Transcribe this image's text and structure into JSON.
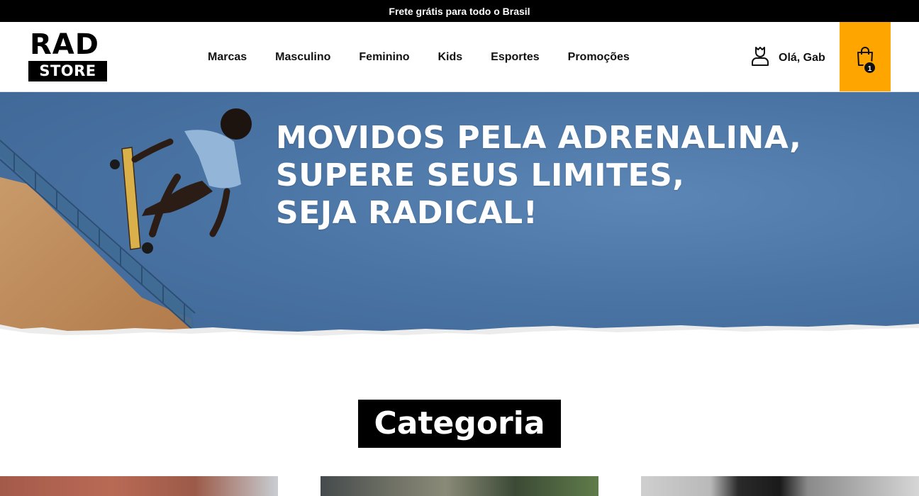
{
  "topbar": {
    "text": "Frete grátis para todo o Brasil"
  },
  "logo": {
    "line1": "RAD",
    "line2": "STORE"
  },
  "nav": {
    "items": [
      {
        "label": "Marcas"
      },
      {
        "label": "Masculino"
      },
      {
        "label": "Feminino"
      },
      {
        "label": "Kids"
      },
      {
        "label": "Esportes"
      },
      {
        "label": "Promoções"
      }
    ]
  },
  "account": {
    "label": "Olá, Gab",
    "icon": "user-icon"
  },
  "cart": {
    "count": "1",
    "icon": "shopping-bag-icon",
    "accent": "#ffa500"
  },
  "hero": {
    "line1": "MOVIDOS PELA ADRENALINA,",
    "line2": "SUPERE SEUS LIMITES,",
    "line3": "SEJA RADICAL!"
  },
  "categories": {
    "heading": "Categoria"
  }
}
